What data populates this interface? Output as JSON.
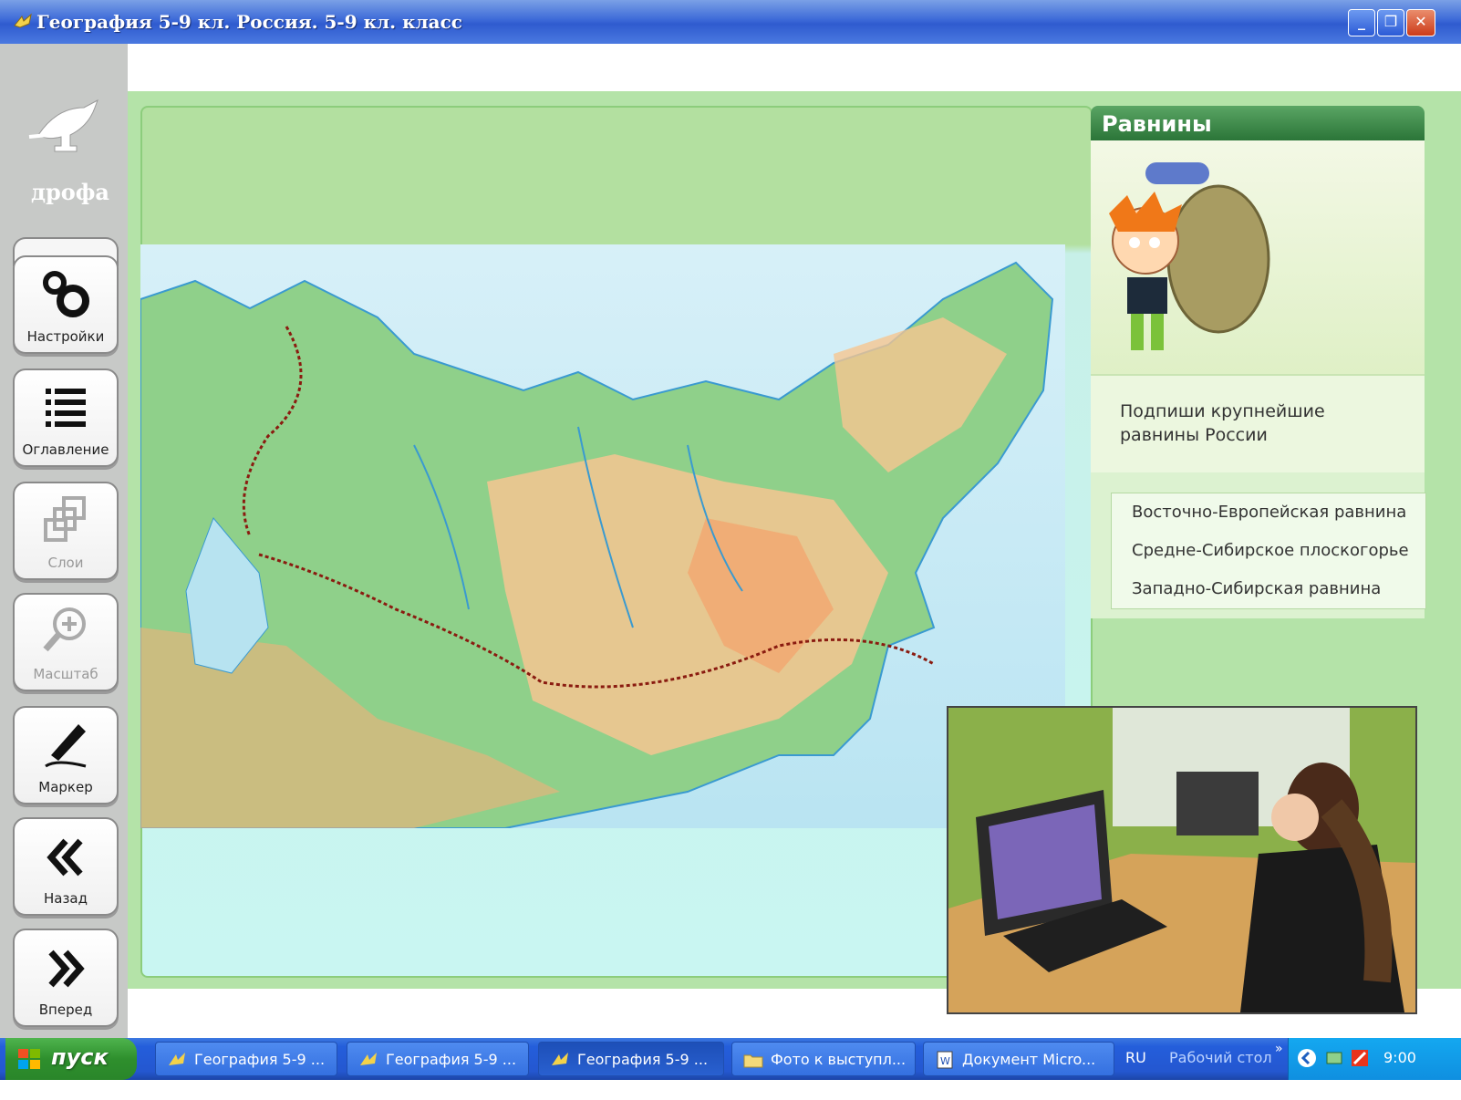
{
  "window": {
    "title": "География 5-9 кл. Россия. 5-9 кл. класс",
    "minimize": "_",
    "restore": "❐",
    "close": "✕"
  },
  "logo": {
    "text": "дрофа"
  },
  "tools": [
    {
      "label": "Настройки",
      "icon": "gears-icon",
      "enabled": true
    },
    {
      "label": "Оглавление",
      "icon": "list-icon",
      "enabled": true
    },
    {
      "label": "Слои",
      "icon": "layers-icon",
      "enabled": false
    },
    {
      "label": "Масштаб",
      "icon": "zoom-icon",
      "enabled": false
    },
    {
      "label": "Маркер",
      "icon": "marker-icon",
      "enabled": true
    },
    {
      "label": "Назад",
      "icon": "back-icon",
      "enabled": true
    },
    {
      "label": "Вперед",
      "icon": "forward-icon",
      "enabled": true
    }
  ],
  "panel": {
    "title": "Равнины",
    "task": "Подпиши крупнейшие равнины России",
    "answers": [
      "Восточно-Европейская равнина",
      "Средне-Сибирское плоскогорье",
      "Западно-Сибирская равнина"
    ]
  },
  "taskbar": {
    "start": "пуск",
    "buttons": [
      {
        "label": "География 5-9 ...",
        "active": false
      },
      {
        "label": "География 5-9 ...",
        "active": false
      },
      {
        "label": "География 5-9 ...",
        "active": true
      },
      {
        "label": "Фото к выступл...",
        "active": false
      },
      {
        "label": "Документ Micro...",
        "active": false
      }
    ],
    "language": "RU",
    "desktop_label": "Рабочий стол",
    "overflow": "»",
    "clock": "9:00"
  },
  "colors": {
    "titlebar": "#3d6ad8",
    "main_bg": "#b4e3a8",
    "panel_header": "#2b7538",
    "taskbar": "#245edb",
    "start": "#2e8f2d",
    "tray": "#0f8fe0"
  }
}
